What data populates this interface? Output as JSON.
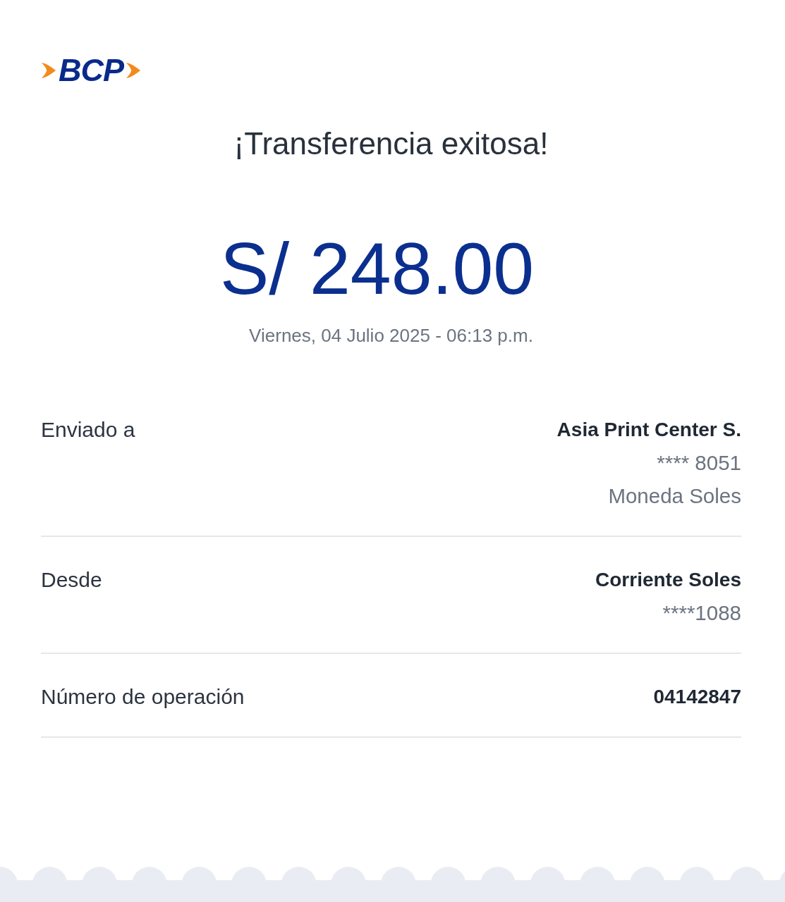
{
  "logo": {
    "text": "BCP"
  },
  "title": "¡Transferencia exitosa!",
  "amount": "S/ 248.00",
  "datetime": "Viernes, 04 Julio 2025 - 06:13 p.m.",
  "details": [
    {
      "label": "Enviado a",
      "value": "Asia Print Center S.",
      "lines": [
        "**** 8051",
        "Moneda Soles"
      ]
    },
    {
      "label": "Desde",
      "value": "Corriente Soles",
      "lines": [
        "****1088"
      ]
    },
    {
      "label": "Número de operación",
      "value": "04142847"
    }
  ]
}
